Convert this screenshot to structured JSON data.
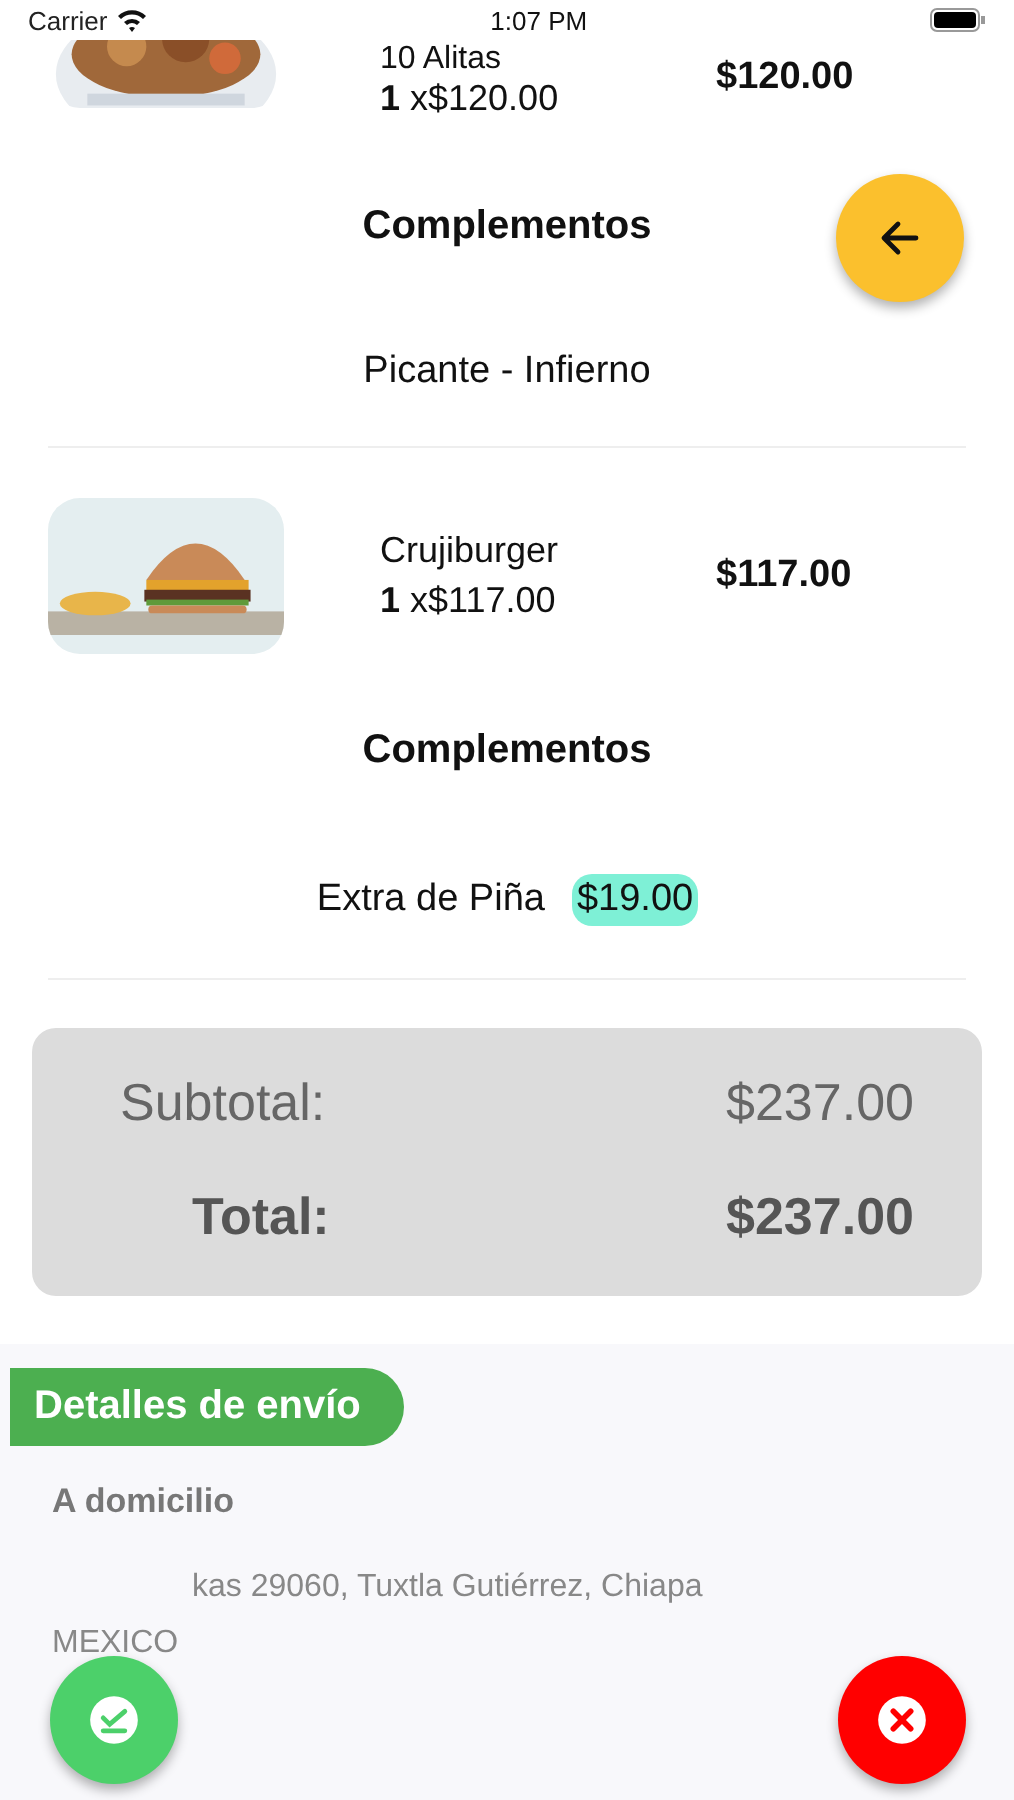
{
  "status_bar": {
    "carrier": "Carrier",
    "time": "1:07 PM"
  },
  "items": [
    {
      "name": "10 Alitas",
      "quantity": "1",
      "unit_price": "x$120.00",
      "price": "$120.00",
      "complements_title": "Complementos",
      "complements": [
        {
          "name": "Picante - Infierno"
        }
      ]
    },
    {
      "name": "Crujiburger",
      "quantity": "1",
      "unit_price": "x$117.00",
      "price": "$117.00",
      "complements_title": "Complementos",
      "complements": [
        {
          "name": "Extra de Piña",
          "price": "$19.00"
        }
      ]
    }
  ],
  "totals": {
    "subtotal_label": "Subtotal:",
    "subtotal": "$237.00",
    "total_label": "Total:",
    "total": "$237.00"
  },
  "shipping": {
    "title": "Detalles de envío",
    "method": "A domicilio",
    "address_lines": [
      "kas 29060, Tuxtla Gutiérrez, Chiapa",
      "MEXICO"
    ]
  }
}
